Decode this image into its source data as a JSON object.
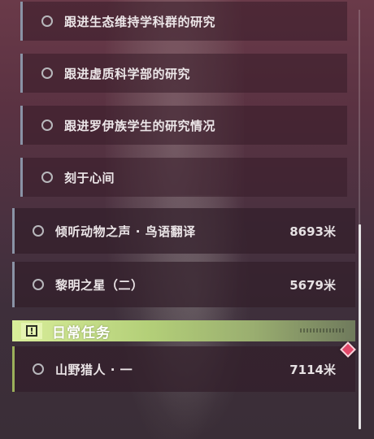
{
  "quests": {
    "sub": [
      {
        "title": "跟进生态维持学科群的研究"
      },
      {
        "title": "跟进虚质科学部的研究"
      },
      {
        "title": "跟进罗伊族学生的研究情况"
      },
      {
        "title": "刻于心间"
      }
    ],
    "main": [
      {
        "title": "倾听动物之声 · 鸟语翻译",
        "distance": "8693米"
      },
      {
        "title": "黎明之星（二）",
        "distance": "5679米"
      }
    ]
  },
  "daily_section": {
    "title": "日常任务",
    "icon": "exclamation-box-icon",
    "tasks": [
      {
        "title": "山野猎人 · 一",
        "distance": "7114米"
      }
    ]
  },
  "colors": {
    "daily_accent": "#c9e38a",
    "marker": "#e2486a"
  }
}
